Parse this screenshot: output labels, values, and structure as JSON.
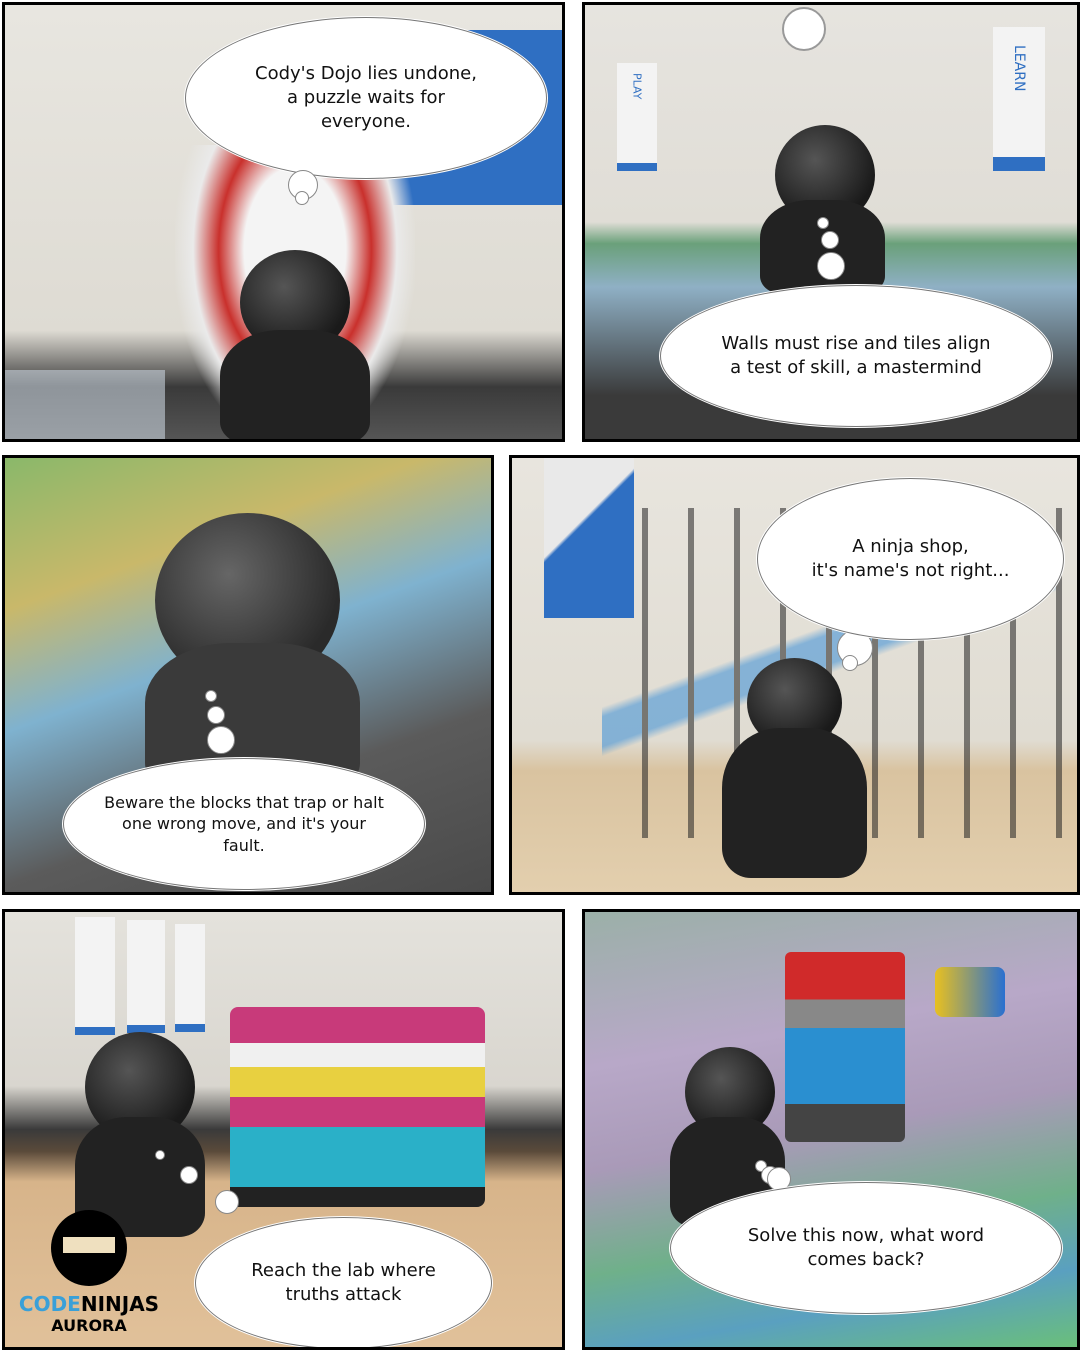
{
  "panels": [
    {
      "caption": "Cody's Dojo lies undone,\na puzzle waits for\neveryone."
    },
    {
      "caption": "Walls must rise and tiles align\na test of skill, a mastermind"
    },
    {
      "caption": "Beware the blocks that trap or halt\none wrong move, and it's your\nfault."
    },
    {
      "caption": "A ninja shop,\nit's name's not right..."
    },
    {
      "caption": "Reach the lab where\ntruths attack"
    },
    {
      "caption": "Solve this now, what word\ncomes back?"
    }
  ],
  "logo": {
    "word1": "CODE",
    "word2": "NINJAS",
    "location": "AURORA"
  },
  "banners": {
    "learn": "LEARN",
    "play": "PLAY",
    "code_ninjas": "CODE NINJAS"
  }
}
